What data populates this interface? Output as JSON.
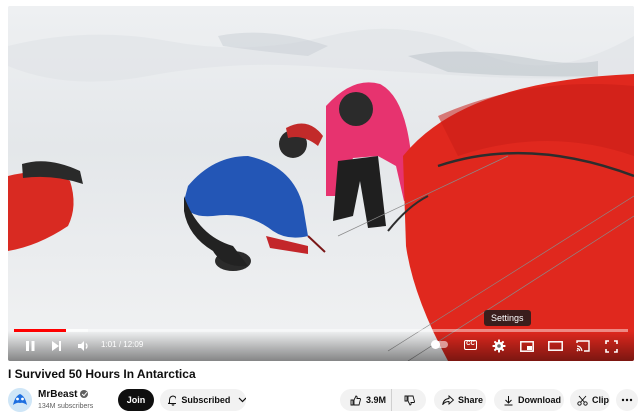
{
  "player": {
    "time_current": "1:01",
    "time_separator": "/",
    "time_total": "12:09",
    "progress_fraction": 0.084,
    "tooltip": "Settings",
    "cc_label": "CC"
  },
  "video": {
    "title": "I Survived 50 Hours In Antarctica"
  },
  "channel": {
    "name": "MrBeast",
    "subscribers": "134M subscribers",
    "join_label": "Join",
    "subscribed_label": "Subscribed"
  },
  "actions": {
    "likes": "3.9M",
    "share_label": "Share",
    "download_label": "Download",
    "clip_label": "Clip"
  },
  "colors": {
    "progress": "#ff0000",
    "tent": "#e0281e"
  }
}
